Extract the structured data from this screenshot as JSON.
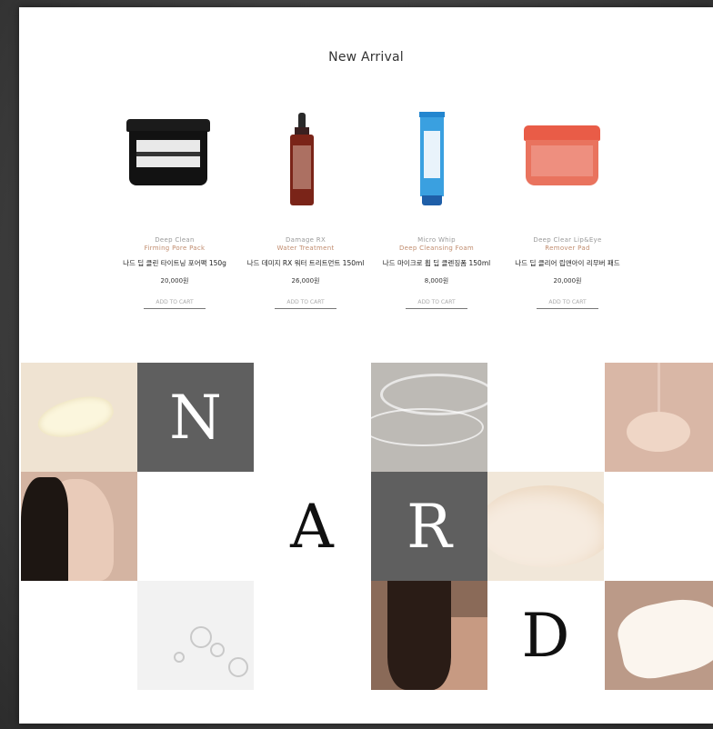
{
  "section_title": "New Arrival",
  "products": [
    {
      "name_en_1": "Deep Clean",
      "name_en_2": "Firming Pore Pack",
      "name_kr": "나드 딥 클린 타이트닝 포어팩 150g",
      "price": "20,000원",
      "cart": "ADD TO CART"
    },
    {
      "name_en_1": "Damage RX",
      "name_en_2": "Water Treatment",
      "name_kr": "나드 데미지 RX 워터 트리트먼트 150ml",
      "price": "26,000원",
      "cart": "ADD TO CART"
    },
    {
      "name_en_1": "Micro Whip",
      "name_en_2": "Deep Cleansing Foam",
      "name_kr": "나드 마이크로 휩 딥 클렌징폼 150ml",
      "price": "8,000원",
      "cart": "ADD TO CART"
    },
    {
      "name_en_1": "Deep Clear Lip&Eye",
      "name_en_2": "Remover Pad",
      "name_kr": "나드 딥 클리어 립앤아이 리무버 패드",
      "price": "20,000원",
      "cart": "ADD TO CART"
    }
  ],
  "brand_letters": {
    "n": "N",
    "a": "A",
    "r": "R",
    "d": "D"
  },
  "colors": {
    "gray_tile": "#5f5f5f",
    "accent_text": "#c08b6d",
    "background": "#ffffff"
  }
}
